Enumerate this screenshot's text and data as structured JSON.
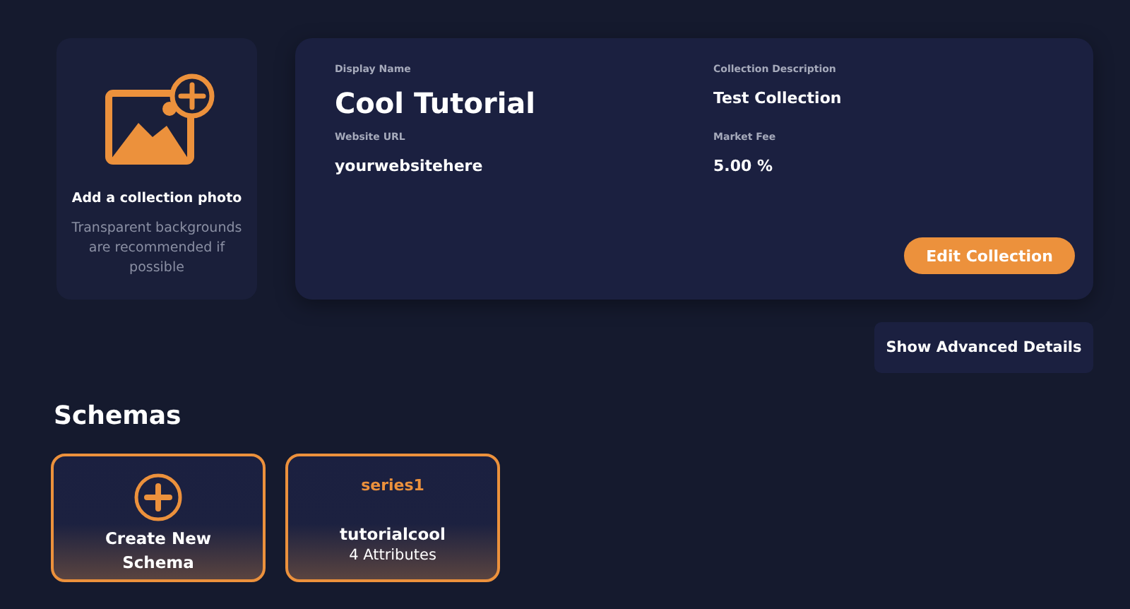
{
  "photo_card": {
    "title": "Add a collection photo",
    "hint": "Transparent backgrounds are recommended if possible"
  },
  "collection": {
    "fields": [
      {
        "label": "Display Name",
        "value": "Cool Tutorial",
        "kind": "title"
      },
      {
        "label": "Collection Description",
        "value": "Test Collection",
        "kind": "text"
      },
      {
        "label": "Website URL",
        "value": "yourwebsitehere",
        "kind": "text"
      },
      {
        "label": "Market Fee",
        "value": "5.00 %",
        "kind": "text"
      }
    ],
    "edit_button": "Edit Collection"
  },
  "advanced_button": "Show Advanced Details",
  "schemas": {
    "heading": "Schemas",
    "cards": [
      {
        "kind": "create",
        "title": "Create New Schema"
      },
      {
        "kind": "schema",
        "series": "series1",
        "title": "tutorialcool",
        "subtitle": "4 Attributes"
      }
    ]
  }
}
